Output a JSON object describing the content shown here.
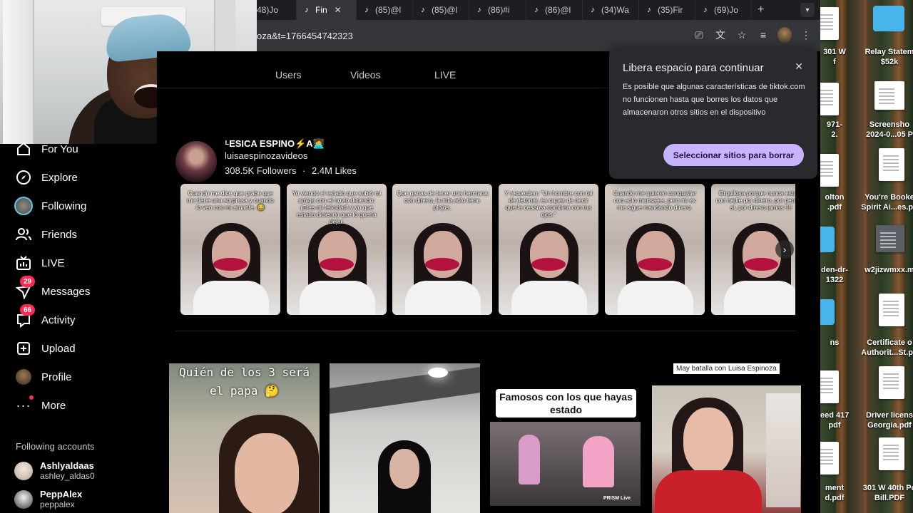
{
  "browser": {
    "tabs": [
      {
        "label": "48)Jo",
        "active": false
      },
      {
        "label": "Fin",
        "active": true
      },
      {
        "label": "(85)@l",
        "active": false
      },
      {
        "label": "(85)@l",
        "active": false
      },
      {
        "label": "(86)#i",
        "active": false
      },
      {
        "label": "(86)@l",
        "active": false
      },
      {
        "label": "(34)Wa",
        "active": false
      },
      {
        "label": "(35)Fir",
        "active": false
      },
      {
        "label": "(69)Jo",
        "active": false
      }
    ],
    "new_tab_glyph": "+",
    "tab_close_glyph": "✕",
    "url": "oza&t=1766454742323",
    "icons": [
      "install-icon",
      "translate-icon",
      "bookmark-star-icon",
      "media-icon",
      "profile-avatar",
      "menu-icon"
    ]
  },
  "sidebar": {
    "nav": [
      {
        "label": "For You",
        "icon": "home-icon"
      },
      {
        "label": "Explore",
        "icon": "compass-icon"
      },
      {
        "label": "Following",
        "icon": "following-avatar"
      },
      {
        "label": "Friends",
        "icon": "friends-icon"
      },
      {
        "label": "LIVE",
        "icon": "live-tv-icon"
      },
      {
        "label": "Messages",
        "icon": "messages-icon",
        "badge": "29"
      },
      {
        "label": "Activity",
        "icon": "activity-icon",
        "badge": "66"
      },
      {
        "label": "Upload",
        "icon": "upload-plus-icon"
      },
      {
        "label": "Profile",
        "icon": "profile-avatar"
      },
      {
        "label": "More",
        "icon": "more-dots-icon"
      }
    ],
    "following_heading": "Following accounts",
    "following_accounts": [
      {
        "name": "Ashlyaldaas",
        "handle": "ashley_aldas0"
      },
      {
        "name": "PeppAlex",
        "handle": "peppalex"
      }
    ]
  },
  "search_tabs": {
    "users": "Users",
    "videos": "Videos",
    "live": "LIVE"
  },
  "account": {
    "display_name": "ᴸESICA ESPINO⚡A👩‍💻",
    "handle": "luisaespinozavideos",
    "followers": "308.5K Followers",
    "separator": "·",
    "likes": "2.4M Likes",
    "next_glyph": "›"
  },
  "account_videos": [
    {
      "caption": "Cuando me dice que grabe que me tiene una sorpresa y cuando lo veo con mi amante. 😂"
    },
    {
      "caption": "Yo viendo el estado que subió mi amiga con el novio diciendo: ¡Eres mi felicidad! y yo que estaba diciendo que lo quería dejar."
    },
    {
      "caption": "Que ganas de tener una hermana con dinero, la mía solo tiene piojos."
    },
    {
      "caption": "Y recuerden: \"Un hombre con tal de detonar, es capaz de decir que la cesárea combina con tus ojos.\""
    },
    {
      "caption": "Cuando me quieren conquistar con solo mensajes, pero mi ex me sigue mandando dinero."
    },
    {
      "caption": "Orgullosa porque nunca estuve con nadie por dinero, por pendeja sí, por dinero jamás !!!!"
    }
  ],
  "video_results": [
    {
      "overlay": "Quién de los 3 será el papa 🤔"
    },
    {
      "overlay": ""
    },
    {
      "overlay": "Famosos con los que hayas estado",
      "tag": "PRISM Live"
    },
    {
      "overlay": "May batalla con Luisa Espinoza"
    }
  ],
  "popup": {
    "title": "Libera espacio para continuar",
    "body": "Es posible que algunas características de tiktok.com no funcionen hasta que borres los datos que almacenaron otros sitios en el dispositivo",
    "button": "Seleccionar sitios para borrar",
    "close_glyph": "✕"
  },
  "desktop": {
    "items": [
      {
        "label1": "301 W",
        "label2": "f"
      },
      {
        "label1": "Relay Statem",
        "label2": "$52k"
      },
      {
        "label1": "971-",
        "label2": "2."
      },
      {
        "label1": "Screensho",
        "label2": "2024-0...05 P"
      },
      {
        "label1": "olton",
        "label2": ".pdf"
      },
      {
        "label1": "You're Booke",
        "label2": "Spirit Ai...es.pd"
      },
      {
        "label1": "den-dr-",
        "label2": "1322"
      },
      {
        "label1": "w2jizwmxx.m",
        "label2": ""
      },
      {
        "label1": "ns",
        "label2": ""
      },
      {
        "label1": "Certificate o",
        "label2": "Authorit...St.pd"
      },
      {
        "label1": "eed 417",
        "label2": "pdf"
      },
      {
        "label1": "Driver licens",
        "label2": "Georgia.pdf"
      },
      {
        "label1": "ment",
        "label2": "d.pdf"
      },
      {
        "label1": "301 W 40th Po",
        "label2": "Bill.PDF"
      }
    ]
  },
  "colors": {
    "accent": "#fe2c55",
    "popup_button": "#c7b3ff",
    "folder": "#48b4ec"
  }
}
